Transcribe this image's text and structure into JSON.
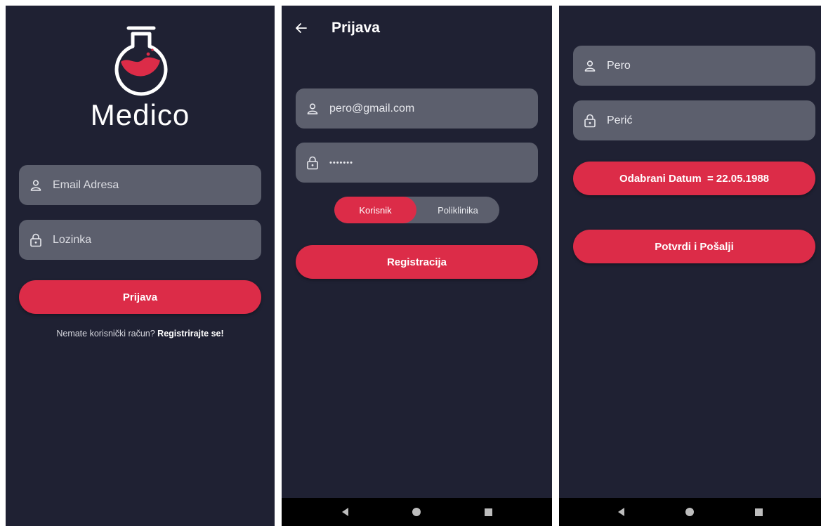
{
  "colors": {
    "background": "#1f2133",
    "field": "#5c5f6d",
    "accent": "#dc2c48",
    "text": "#ffffff"
  },
  "login": {
    "logo_text": "Medico",
    "email_placeholder": "Email Adresa",
    "password_placeholder": "Lozinka",
    "login_button": "Prijava",
    "no_account_text": "Nemate korisnički račun?",
    "register_link": "Registrirajte se!"
  },
  "register": {
    "title": "Prijava",
    "email_value": "pero@gmail.com",
    "password_value": "•••••••",
    "segment": {
      "options": [
        "Korisnik",
        "Poliklinika"
      ],
      "selected": "Korisnik"
    },
    "register_button": "Registracija"
  },
  "details": {
    "first_name": "Pero",
    "last_name": "Perić",
    "date_button": "Odabrani Datum  = 22.05.1988",
    "submit_button": "Potvrdi i Pošalji"
  },
  "icons": [
    "person-icon",
    "lock-icon",
    "back-arrow-icon",
    "flask-logo-icon",
    "nav-back-icon",
    "nav-home-icon",
    "nav-recent-icon"
  ]
}
